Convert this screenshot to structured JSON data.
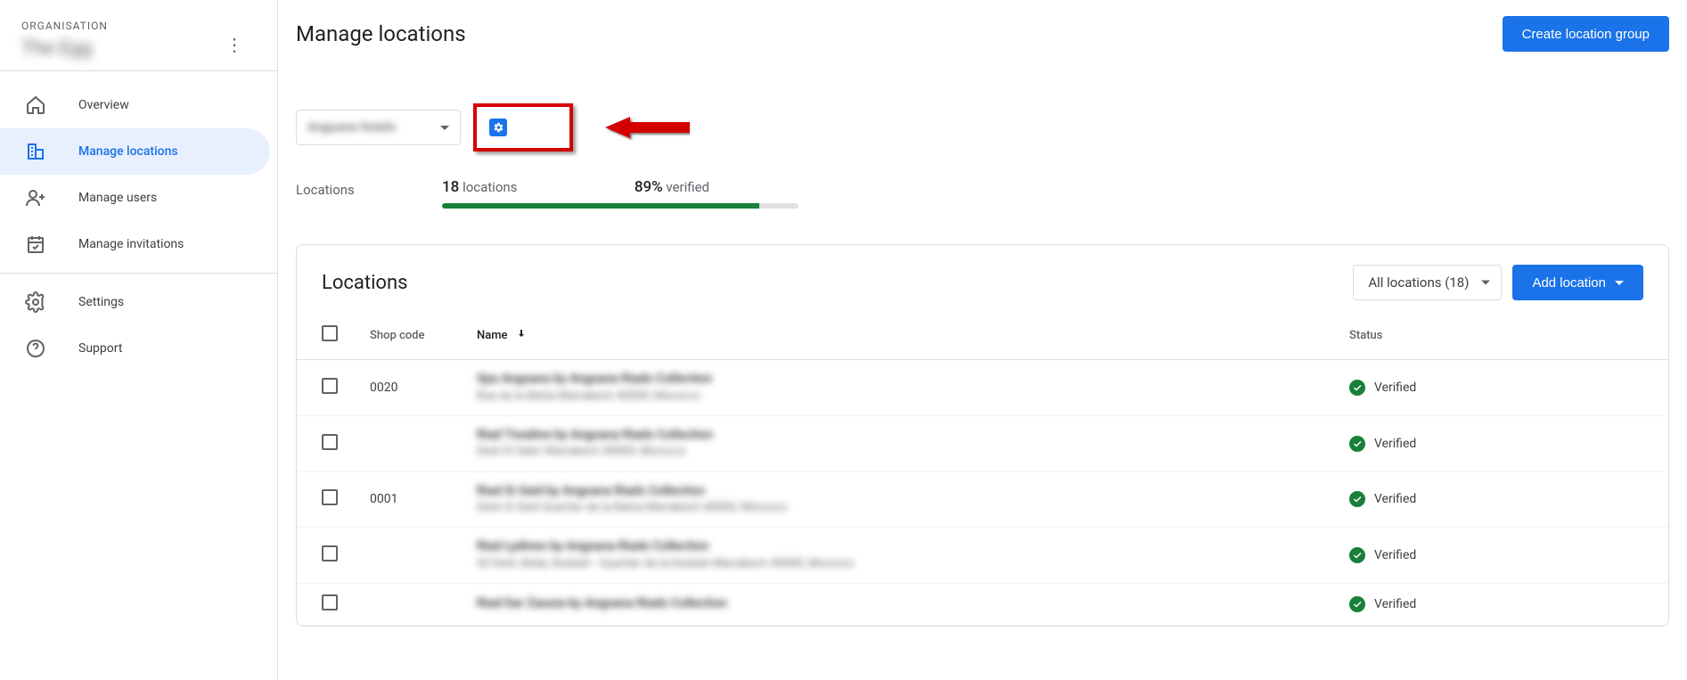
{
  "sidebar": {
    "org_label": "ORGANISATION",
    "org_name": "The Egg",
    "items": [
      {
        "label": "Overview"
      },
      {
        "label": "Manage locations"
      },
      {
        "label": "Manage users"
      },
      {
        "label": "Manage invitations"
      },
      {
        "label": "Settings"
      },
      {
        "label": "Support"
      }
    ]
  },
  "main": {
    "title": "Manage locations",
    "create_group_btn": "Create location group",
    "group_select": "Angsana Hotels",
    "locations_label": "Locations",
    "total_count": "18",
    "total_label": "locations",
    "verified_pct": "89%",
    "verified_label": "verified"
  },
  "card": {
    "title": "Locations",
    "filter_btn": "All locations (18)",
    "add_btn": "Add location",
    "columns": {
      "shop": "Shop code",
      "name": "Name",
      "status": "Status"
    },
    "rows": [
      {
        "shop": "0020",
        "name": "Spa Angsana by Angsana Riads Collection",
        "addr": "Rue de la Bahia Marrakech 40000, Morocco",
        "status": "Verified"
      },
      {
        "shop": "",
        "name": "Riad Tiwaline by Angsana Riads Collection",
        "addr": "Derb El Sakir Marrakech 40000, Morocco",
        "status": "Verified"
      },
      {
        "shop": "0001",
        "name": "Riad Si Said by Angsana Riads Collection",
        "addr": "Derb Si Said Quartier de la Bahia Marrakech 40000, Morocco",
        "status": "Verified"
      },
      {
        "shop": "",
        "name": "Riad Lydines by Angsana Riads Collection",
        "addr": "43 Derb Abda, Kasbah - Quartier de la Kasbah Marrakech 40000, Morocco",
        "status": "Verified"
      },
      {
        "shop": "",
        "name": "Riad Dar Zaouia by Angsana Riads Collection",
        "addr": "",
        "status": "Verified"
      }
    ]
  }
}
